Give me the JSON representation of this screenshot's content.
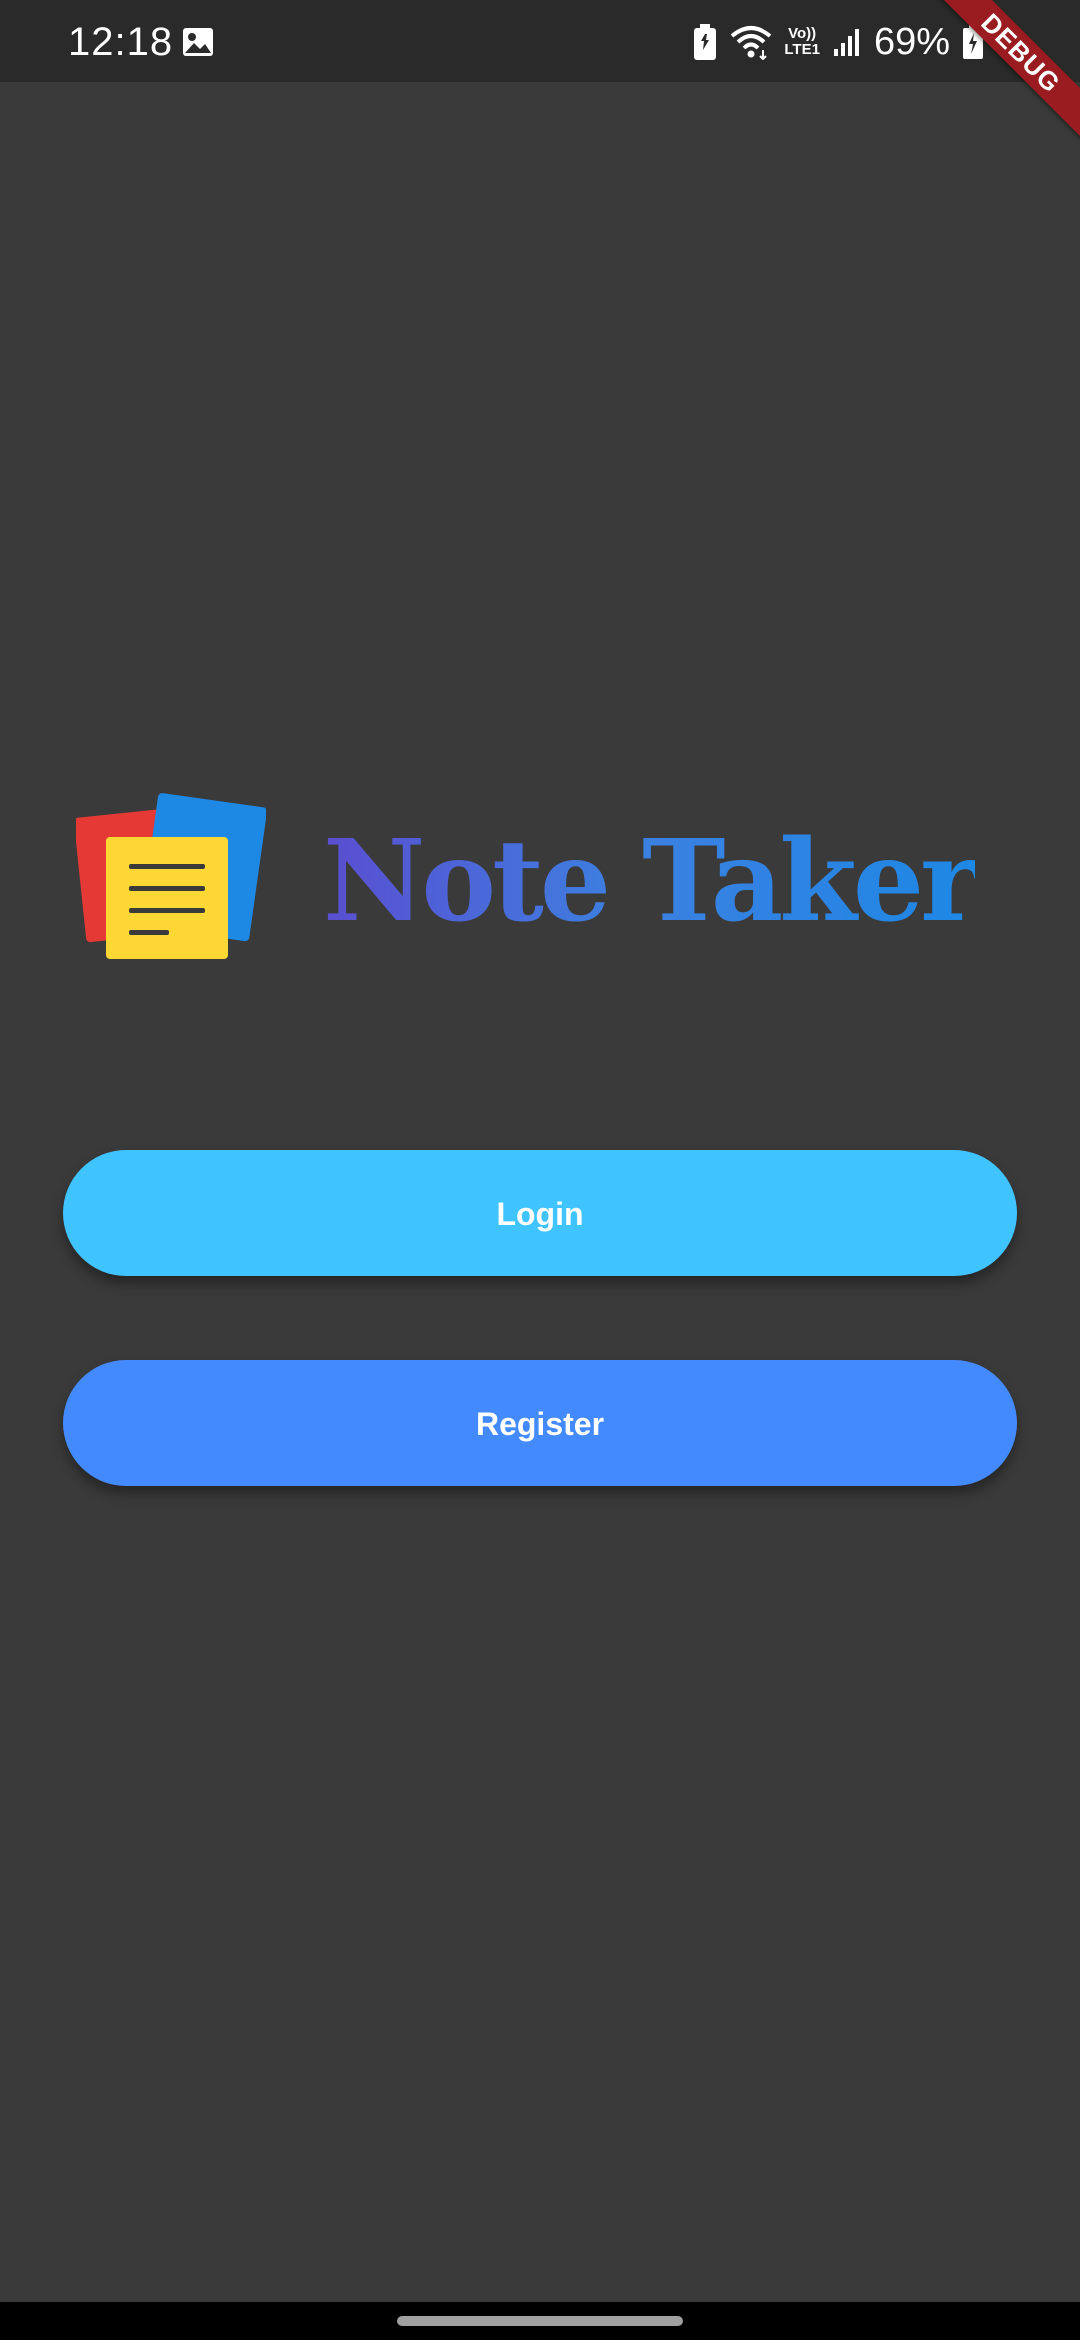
{
  "status_bar": {
    "time": "12:18",
    "volte_top": "Vo))",
    "volte_bottom": "LTE1",
    "battery_percent": "69%",
    "icons": [
      "gallery-icon",
      "battery-saver-icon",
      "wifi-icon",
      "signal-icon",
      "battery-charging-icon"
    ]
  },
  "debug_banner": "DEBUG",
  "app": {
    "title": "Note Taker",
    "logo_icon": "notes-stack-icon"
  },
  "buttons": {
    "login": "Login",
    "register": "Register"
  },
  "colors": {
    "background": "#3a3a3a",
    "status_bar": "#2a2a2a",
    "login_button": "#40c4ff",
    "register_button": "#448aff",
    "title_gradient_start": "#5a4ed0",
    "title_gradient_end": "#1e88e5",
    "debug_ribbon": "#9b1c20"
  }
}
